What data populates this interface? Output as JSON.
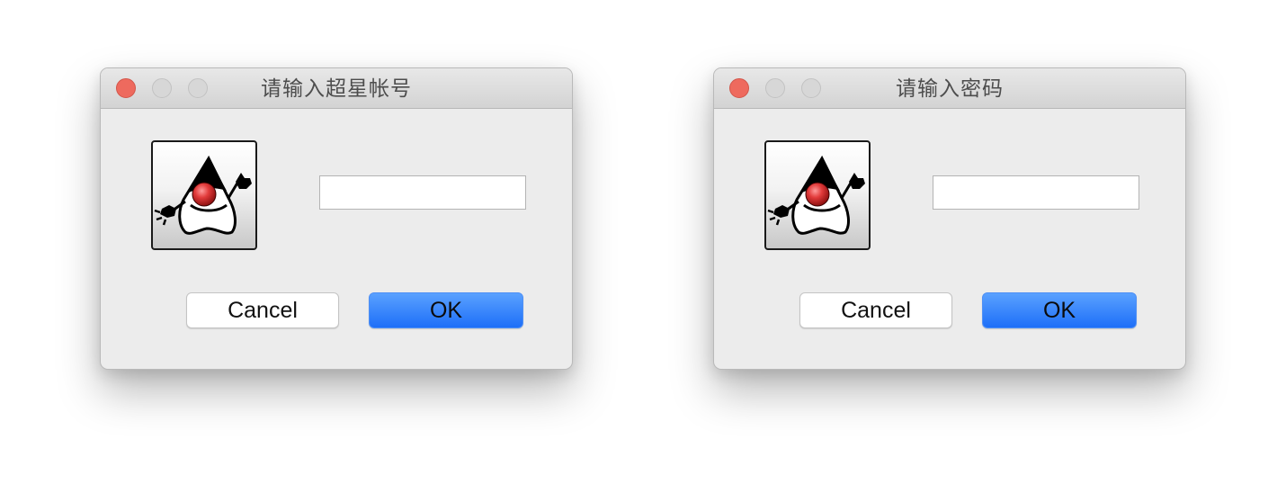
{
  "dialogs": [
    {
      "title": "请输入超星帐号",
      "input": {
        "value": "",
        "placeholder": ""
      },
      "buttons": {
        "cancel": "Cancel",
        "ok": "OK"
      },
      "icon": "java-duke-icon"
    },
    {
      "title": "请输入密码",
      "input": {
        "value": "",
        "placeholder": ""
      },
      "buttons": {
        "cancel": "Cancel",
        "ok": "OK"
      },
      "icon": "java-duke-icon"
    }
  ],
  "colors": {
    "close_button": "#ee6a5e",
    "inactive_button": "#d7d7d7",
    "ok_button": "#1e6ff8",
    "dialog_background": "#ececec"
  }
}
